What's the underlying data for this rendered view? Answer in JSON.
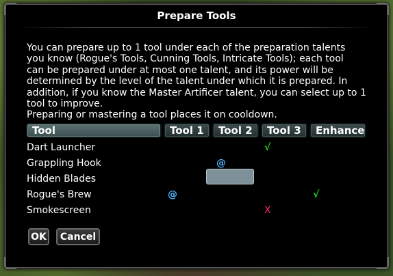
{
  "dialog": {
    "title": "Prepare Tools",
    "description_lines": [
      "You can prepare up to 1 tool under each of the preparation talents",
      "you know (Rogue's Tools, Cunning Tools, Intricate Tools); each tool",
      "can be prepared under at most one talent, and its power will be",
      "determined by the level of the talent under which it is prepared.  In",
      "addition, if you know the Master Artificer talent, you can select up to 1",
      "tool to improve.",
      "Preparing or mastering a tool places it on cooldown."
    ]
  },
  "table": {
    "headers": [
      "Tool",
      "Tool 1",
      "Tool 2",
      "Tool 3",
      "Enhance"
    ],
    "rows": [
      {
        "name": "Dart Launcher",
        "tool1": "",
        "tool2": "",
        "tool3": "√",
        "enhance": ""
      },
      {
        "name": "Grappling Hook",
        "tool1": "",
        "tool2": "@",
        "tool3": "",
        "enhance": ""
      },
      {
        "name": "Hidden Blades",
        "tool1": "",
        "tool2": "",
        "tool3": "",
        "enhance": ""
      },
      {
        "name": "Rogue's Brew",
        "tool1": "@",
        "tool2": "",
        "tool3": "",
        "enhance": "√"
      },
      {
        "name": "Smokescreen",
        "tool1": "",
        "tool2": "",
        "tool3": "X",
        "enhance": ""
      }
    ]
  },
  "buttons": {
    "ok_label": "OK",
    "cancel_label": "Cancel"
  },
  "colors": {
    "check": "#22d422",
    "prepared_at": "#4fb4ff",
    "cancel_x": "#ff2a6a",
    "cell_highlight": "#7e9098"
  }
}
